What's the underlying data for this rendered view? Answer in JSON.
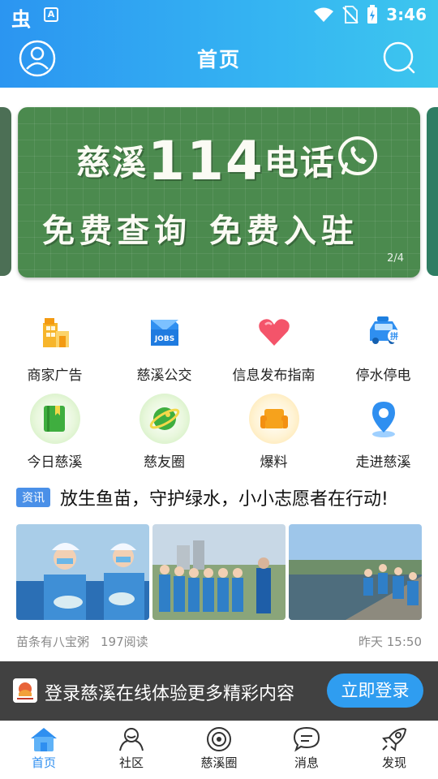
{
  "status_bar": {
    "app_icon_1": "虫",
    "app_icon_2": "A",
    "time": "3:46"
  },
  "navbar": {
    "title": "首页",
    "icons": [
      "user-avatar-icon",
      "search-icon"
    ]
  },
  "banner": {
    "line1_prefix": "慈溪",
    "line1_number": "114",
    "line1_suffix": "电话",
    "line2_left": "免费查询",
    "line2_right": "免费入驻",
    "page_indicator": "2/4",
    "background_color": "#4b8a4e"
  },
  "grid": {
    "row1": [
      {
        "label": "商家广告",
        "icon": "building-icon"
      },
      {
        "label": "慈溪公交",
        "icon": "jobs-folder-icon"
      },
      {
        "label": "信息发布指南",
        "icon": "heart-icon"
      },
      {
        "label": "停水停电",
        "icon": "taxi-icon"
      }
    ],
    "row2": [
      {
        "label": "今日慈溪",
        "icon": "book-icon"
      },
      {
        "label": "慈友圈",
        "icon": "planet-icon"
      },
      {
        "label": "爆料",
        "icon": "sofa-icon"
      },
      {
        "label": "走进慈溪",
        "icon": "location-pin-icon"
      }
    ]
  },
  "news": {
    "tag": "资讯",
    "title": "放生鱼苗，守护绿水，小小志愿者在行动!",
    "author": "苗条有八宝粥",
    "reads": "197阅读",
    "time": "昨天 15:50"
  },
  "login_bar": {
    "text": "登录慈溪在线体验更多精彩内容",
    "button": "立即登录"
  },
  "tabbar": {
    "active_color": "#2f8ff0",
    "items": [
      {
        "label": "首页",
        "icon": "home-icon"
      },
      {
        "label": "社区",
        "icon": "community-icon"
      },
      {
        "label": "慈溪圈",
        "icon": "circle-icon"
      },
      {
        "label": "消息",
        "icon": "message-icon"
      },
      {
        "label": "发现",
        "icon": "rocket-icon"
      }
    ]
  }
}
